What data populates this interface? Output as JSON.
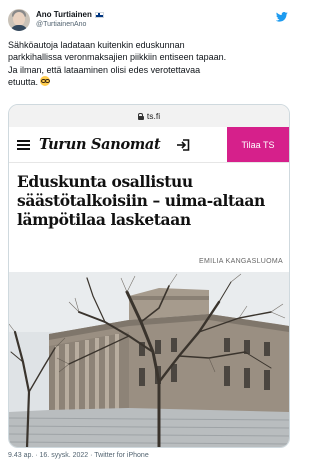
{
  "tweet": {
    "author": {
      "display_name": "Ano Turtiainen",
      "handle": "@TurtiainenAno",
      "flag": "finland-flag"
    },
    "text_lines": [
      "Sähköautoja ladataan kuitenkin eduskunnan",
      "parkkihallissa veronmaksajien piikkiin entiseen tapaan.",
      "Ja ilman, että lataaminen olisi edes verotettavaa",
      "etuutta."
    ],
    "emoji": "nerd-face-glasses",
    "timestamp": "9.43 ap. · 16. syysk. 2022 · Twitter for iPhone"
  },
  "card": {
    "url": "ts.fi",
    "brand": "Turun Sanomat",
    "subscribe_label": "Tilaa TS",
    "headline_lines": [
      "Eduskunta osallistuu",
      "säästötalkoisiin – uima-altaan",
      "lämpötilaa lasketaan"
    ],
    "byline": "EMILIA KANGASLUOMA"
  },
  "colors": {
    "accent": "#d6208b",
    "twitter_blue": "#1d9bf0",
    "text": "#0f1419",
    "muted": "#536471"
  }
}
